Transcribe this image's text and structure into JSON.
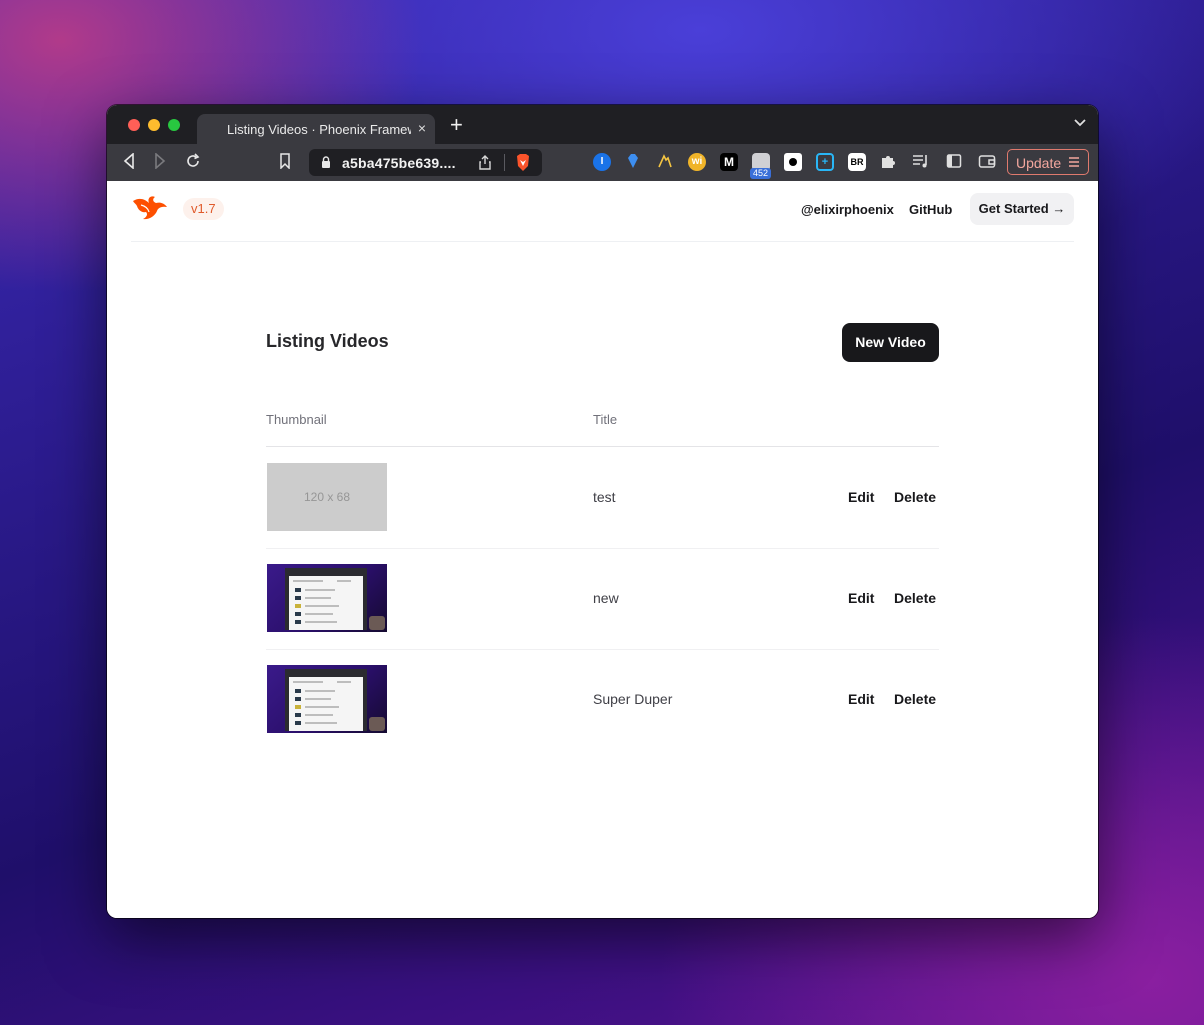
{
  "browser": {
    "tab_title": "Listing Videos · Phoenix Framework",
    "tab_close": "×",
    "new_tab": "+",
    "url": "a5ba475be639....",
    "extension_badge_count": "452",
    "update_label": "Update",
    "extension_labels": {
      "wi": "wi",
      "m": "M",
      "br": "BR"
    }
  },
  "header": {
    "version": "v1.7",
    "links": [
      "@elixirphoenix",
      "GitHub"
    ],
    "cta": "Get Started →"
  },
  "main": {
    "title": "Listing Videos",
    "new_button": "New Video",
    "columns": [
      "Thumbnail",
      "Title"
    ],
    "rows": [
      {
        "thumbnail_text": "120 x 68",
        "title": "test",
        "edit": "Edit",
        "delete": "Delete"
      },
      {
        "thumbnail_text": "",
        "title": "new",
        "edit": "Edit",
        "delete": "Delete"
      },
      {
        "thumbnail_text": "",
        "title": "Super Duper",
        "edit": "Edit",
        "delete": "Delete"
      }
    ]
  },
  "colors": {
    "brand": "#e05a2b",
    "primary_button": "#18181b",
    "update_button_border": "#e07a6e"
  }
}
